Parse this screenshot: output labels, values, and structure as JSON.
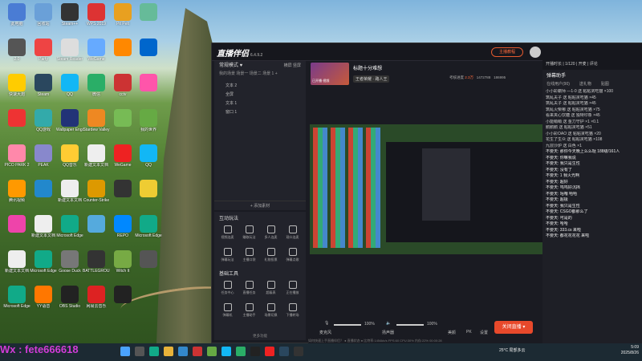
{
  "desktop_icons": [
    {
      "label": "此电脑",
      "c": "#4a7cd4"
    },
    {
      "label": "回收站",
      "c": "#6aa0d8"
    },
    {
      "label": "Steam++",
      "c": "#333"
    },
    {
      "label": "WPS 2019",
      "c": "#d33"
    },
    {
      "label": "Pit Pelt",
      "c": "#e8a020"
    },
    {
      "label": "",
      "c": "#6b9"
    },
    {
      "label": "2.0",
      "c": "#555"
    },
    {
      "label": "Party",
      "c": "#e44"
    },
    {
      "label": "Steam Reader",
      "c": "#ddd"
    },
    {
      "label": "WeGame",
      "c": "#6af"
    },
    {
      "label": "",
      "c": "#f80"
    },
    {
      "label": "",
      "c": "#06c"
    },
    {
      "label": "快速大炮",
      "c": "#fc0"
    },
    {
      "label": "Steam",
      "c": "#2a475e"
    },
    {
      "label": "QQ",
      "c": "#12b7f5"
    },
    {
      "label": "微信",
      "c": "#2aae67"
    },
    {
      "label": "cctv",
      "c": "#c33"
    },
    {
      "label": "",
      "c": "#f5a"
    },
    {
      "label": "",
      "c": "#e33"
    },
    {
      "label": "QQ游戏",
      "c": "#3aa"
    },
    {
      "label": "Wallpaper Engine",
      "c": "#237"
    },
    {
      "label": "Stardew Valley",
      "c": "#e82"
    },
    {
      "label": "",
      "c": "#7b5"
    },
    {
      "label": "我的世界",
      "c": "#6a4"
    },
    {
      "label": "PICO PARK 2",
      "c": "#f8a"
    },
    {
      "label": "PEAK",
      "c": "#88c"
    },
    {
      "label": "QQ音乐",
      "c": "#fc3"
    },
    {
      "label": "新建文本文档",
      "c": "#eee"
    },
    {
      "label": "WeGame",
      "c": "#e22"
    },
    {
      "label": "QQ",
      "c": "#12b7f5"
    },
    {
      "label": "腾讯视频",
      "c": "#f90"
    },
    {
      "label": "",
      "c": "#28c"
    },
    {
      "label": "新建文本文档",
      "c": "#eee"
    },
    {
      "label": "Counter-Strike",
      "c": "#d90"
    },
    {
      "label": "",
      "c": "#333"
    },
    {
      "label": "",
      "c": "#ec3"
    },
    {
      "label": "",
      "c": "#e4a"
    },
    {
      "label": "新建文本文档",
      "c": "#eee"
    },
    {
      "label": "Microsoft Edge",
      "c": "#1a8"
    },
    {
      "label": "",
      "c": "#5ad"
    },
    {
      "label": "REPO",
      "c": "#08f"
    },
    {
      "label": "Microsoft Edge",
      "c": "#1a8"
    },
    {
      "label": "新建文本文档",
      "c": "#eee"
    },
    {
      "label": "Microsoft Edge",
      "c": "#1a8"
    },
    {
      "label": "Goose Duck",
      "c": "#777"
    },
    {
      "label": "BATTLEGROUNDS",
      "c": "#333"
    },
    {
      "label": "Witch It",
      "c": "#7a4"
    },
    {
      "label": "",
      "c": "#555"
    },
    {
      "label": "Microsoft Edge",
      "c": "#1a8"
    },
    {
      "label": "YY语音",
      "c": "#f70"
    },
    {
      "label": "OBS Studio",
      "c": "#222"
    },
    {
      "label": "网易云音乐",
      "c": "#d22"
    },
    {
      "label": "",
      "c": "#222"
    }
  ],
  "app": {
    "name": "直播伴侣",
    "version": "6.4.9.2",
    "menu_btn": "主播教程",
    "top_tabs": "开播时长 | 1/120 | 开麦 | 评论"
  },
  "left": {
    "mode": "常规模式 ♥",
    "switch": "横屏 竖屏",
    "tabs": "我的场景  场景一  场景二  场景 1  +",
    "items": [
      "文本 2",
      "全屏",
      "文本 1",
      "窗口 1"
    ],
    "add": "+ 添加素材"
  },
  "interact": {
    "title": "互动玩法",
    "tools": [
      "视频连麦",
      "赚取玩法",
      "多人连麦",
      "观众连麦",
      "弹幕玩法",
      "主播口袋",
      "礼物投票",
      "弹幕点歌"
    ]
  },
  "basic": {
    "title": "基础工具",
    "tools": [
      "任务中心",
      "直播任务",
      "超级表",
      "正在播放",
      "弹幕机",
      "主播助手",
      "场景切换",
      "下播转场"
    ],
    "more": "更多功能"
  },
  "stream": {
    "title": "标题十分难想",
    "category": "王者荣耀 · 路人王",
    "cover_label": "已开播·视频",
    "exp": "考核进度",
    "count1": "2.3万",
    "count2": "1472788",
    "count3": "186995"
  },
  "ctrl": {
    "mic": "麦克风",
    "mic_vol": "100%",
    "spk": "扬声器",
    "spk_vol": "100%",
    "beauty": "美颜",
    "pk": "PK",
    "settings": "设置",
    "start": "关闭直播 ▾"
  },
  "statusbar": "如何快速上手直播伴侣？   ● 直播状态  ● 比特率:1454kb/s  FPS:60  CPU:30%  内存:22%  00:00:28",
  "chat": {
    "title": "弹幕助手",
    "tabs": [
      "在线用户(90)",
      "送礼物",
      "贴图"
    ],
    "messages": [
      "小小彩霸师 —1-0 送 粘粘贪吃猫 ×100",
      "筑乱夫子 送 粘粘贪吃猫 ×45",
      "筑乱夫子 送 粘粘贪吃猫 ×45",
      "筑乱火柴哪 送 粘粘贪吃猫 ×75",
      "看来夹心饮糖 送 独特印象 ×45",
      "小能萌萌 送 金力守护 ×1 ×0.1",
      "鹅鹅鹅 送 粘粘贪吃猫 ×51",
      "小小彩OAO 送 粘粘贪吃猫 ×20",
      "花生了生众 送 粘粘贪吃猫 ×108",
      "九层沙炉 送 白色 ×1",
      "不要天: 那你今天晚上么么哒 188级/161人",
      "不要天: 你嘛我说",
      "不要天: 我只是生性",
      "不要天: 没有了",
      "不要天: 1 我火光啊",
      "不要天: 超好",
      "不要天: 呜呜好沉挡",
      "不要天: 咕噜 哈哈",
      "不要天: 超极",
      "不要天: 我只是生性",
      "不要天: CSGO都那么了",
      "不要天: 可是的",
      "不要天: 哈哈",
      "不要天: 333.cs 来啦",
      "不要天: 都花花花花 来啦"
    ]
  },
  "taskbar": {
    "weather": "25°C 局部多云",
    "time": "5:09",
    "date": "2025/8/26"
  },
  "watermark": "Wx : fete666618"
}
